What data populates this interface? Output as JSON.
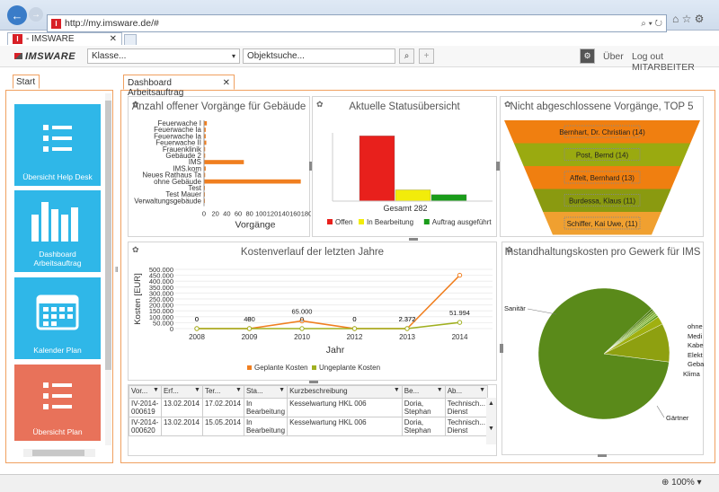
{
  "browser": {
    "url": "http://my.imsware.de/#",
    "tab_title": "- IMSWARE",
    "zoom": "100%"
  },
  "header": {
    "logo": "IMSWARE",
    "class_select": "Klasse...",
    "object_search": "Objektsuche...",
    "about": "Über",
    "logout": "Log out MITARBEITER"
  },
  "sidebar": {
    "tab": "Start",
    "tiles": [
      {
        "label": "Übersicht Help Desk",
        "color": "#2fb7e8"
      },
      {
        "label": "Dashboard Arbeitsauftrag",
        "color": "#2fb7e8"
      },
      {
        "label": "Kalender Plan",
        "color": "#2fb7e8"
      },
      {
        "label": "Übersicht Plan",
        "color": "#e8725a"
      }
    ]
  },
  "main_tab": "Dashboard Arbeitsauftrag",
  "panels": {
    "open_items_title": "Anzahl offener Vorgänge für Gebäude",
    "status_title": "Aktuelle Statusübersicht",
    "top5_title": "Nicht abgeschlossene Vorgänge, TOP 5",
    "cost_title": "Kostenverlauf der letzten Jahre",
    "maint_title": "Instandhaltungskosten pro Gewerk für IMS"
  },
  "chart_data": [
    {
      "type": "bar",
      "title": "Anzahl offener Vorgänge für Gebäude",
      "orientation": "horizontal",
      "xlabel": "Vorgänge",
      "categories": [
        "Feuerwache I",
        "Feuerwache Ia",
        "Feuerwache Ia",
        "Feuerwache II",
        "Frauenklinik",
        "Gebäude 2",
        "IMS",
        "IMS.kom",
        "Neues Rathaus Ta",
        "ohne Gebäude",
        "Test",
        "Test Mauer",
        "Verwaltungsgebäude"
      ],
      "values": [
        5,
        3,
        3,
        4,
        2,
        2,
        70,
        3,
        2,
        170,
        1,
        1,
        1
      ],
      "xticks": [
        "0",
        "20",
        "40",
        "60",
        "80",
        "100",
        "120",
        "140",
        "160",
        "180"
      ],
      "xlim": [
        0,
        180
      ]
    },
    {
      "type": "bar",
      "title": "Aktuelle Statusübersicht",
      "categories": [
        "Offen",
        "In Bearbeitung",
        "Auftrag ausgeführt"
      ],
      "values": [
        220,
        38,
        22
      ],
      "colors": [
        "#e8201c",
        "#f2ec0a",
        "#1a9c1a"
      ],
      "total_label": "Gesamt 282",
      "ylim": [
        0,
        230
      ]
    },
    {
      "type": "funnel",
      "title": "Nicht abgeschlossene Vorgänge, TOP 5",
      "categories": [
        "Bernhart, Dr. Christian (14)",
        "Post, Bernd (14)",
        "Affelt, Bernhard (13)",
        "Burdessa, Klaus (11)",
        "Schiffer, Kai Uwe, (11)"
      ],
      "values": [
        14,
        14,
        13,
        11,
        11
      ],
      "colors": [
        "#f07f10",
        "#9aaa10",
        "#f07f10",
        "#8a9a10",
        "#f0a030"
      ]
    },
    {
      "type": "line",
      "title": "Kostenverlauf der letzten Jahre",
      "xlabel": "Jahr",
      "ylabel": "Kosten [EUR]",
      "x": [
        "2008",
        "2009",
        "2010",
        "2012",
        "2013",
        "2014"
      ],
      "yticks": [
        "500.000",
        "450.000",
        "400.000",
        "350.000",
        "300.000",
        "250.000",
        "200.000",
        "150.000",
        "100.000",
        "50.000",
        "0"
      ],
      "ylim": [
        0,
        500000
      ],
      "series": [
        {
          "name": "Geplante Kosten",
          "color": "#f07f20",
          "values": [
            0,
            0,
            65000,
            0,
            0,
            450000
          ],
          "labels": [
            "0",
            "0",
            "65.000",
            "0",
            "2.372",
            ""
          ]
        },
        {
          "name": "Ungeplante Kosten",
          "color": "#a0b020",
          "values": [
            0,
            0,
            0,
            0,
            0,
            51994
          ],
          "labels": [
            "0",
            "480",
            "0",
            "0",
            "2.372",
            "51.994"
          ]
        }
      ]
    },
    {
      "type": "pie",
      "title": "Instandhaltungskosten pro Gewerk für IMS",
      "categories": [
        "Sanitär",
        "ohne",
        "Medi",
        "Kabe",
        "Elekt",
        "Geba",
        "Klima",
        "Gärtner"
      ],
      "values": [
        86,
        0.5,
        0.5,
        0.5,
        0.5,
        0.5,
        2,
        9.5
      ],
      "colors": [
        "#5a8a1a",
        "#4a7a10",
        "#6a9a20",
        "#7aaa30",
        "#8aba40",
        "#5a9a10",
        "#a0b010",
        "#8ea010"
      ]
    }
  ],
  "table": {
    "headers": [
      "Vor...",
      "Erf...",
      "Ter...",
      "Sta...",
      "Kurzbeschreibung",
      "Be...",
      "Ab..."
    ],
    "rows": [
      [
        "IV-2014-000619",
        "13.02.2014",
        "17.02.2014",
        "In Bearbeitung",
        "Kesselwartung HKL 006",
        "Doria, Stephan",
        "Technisch... Dienst"
      ],
      [
        "IV-2014-000620",
        "13.02.2014",
        "15.05.2014",
        "In Bearbeitung",
        "Kesselwartung HKL 006",
        "Doria, Stephan",
        "Technisch... Dienst"
      ]
    ]
  }
}
